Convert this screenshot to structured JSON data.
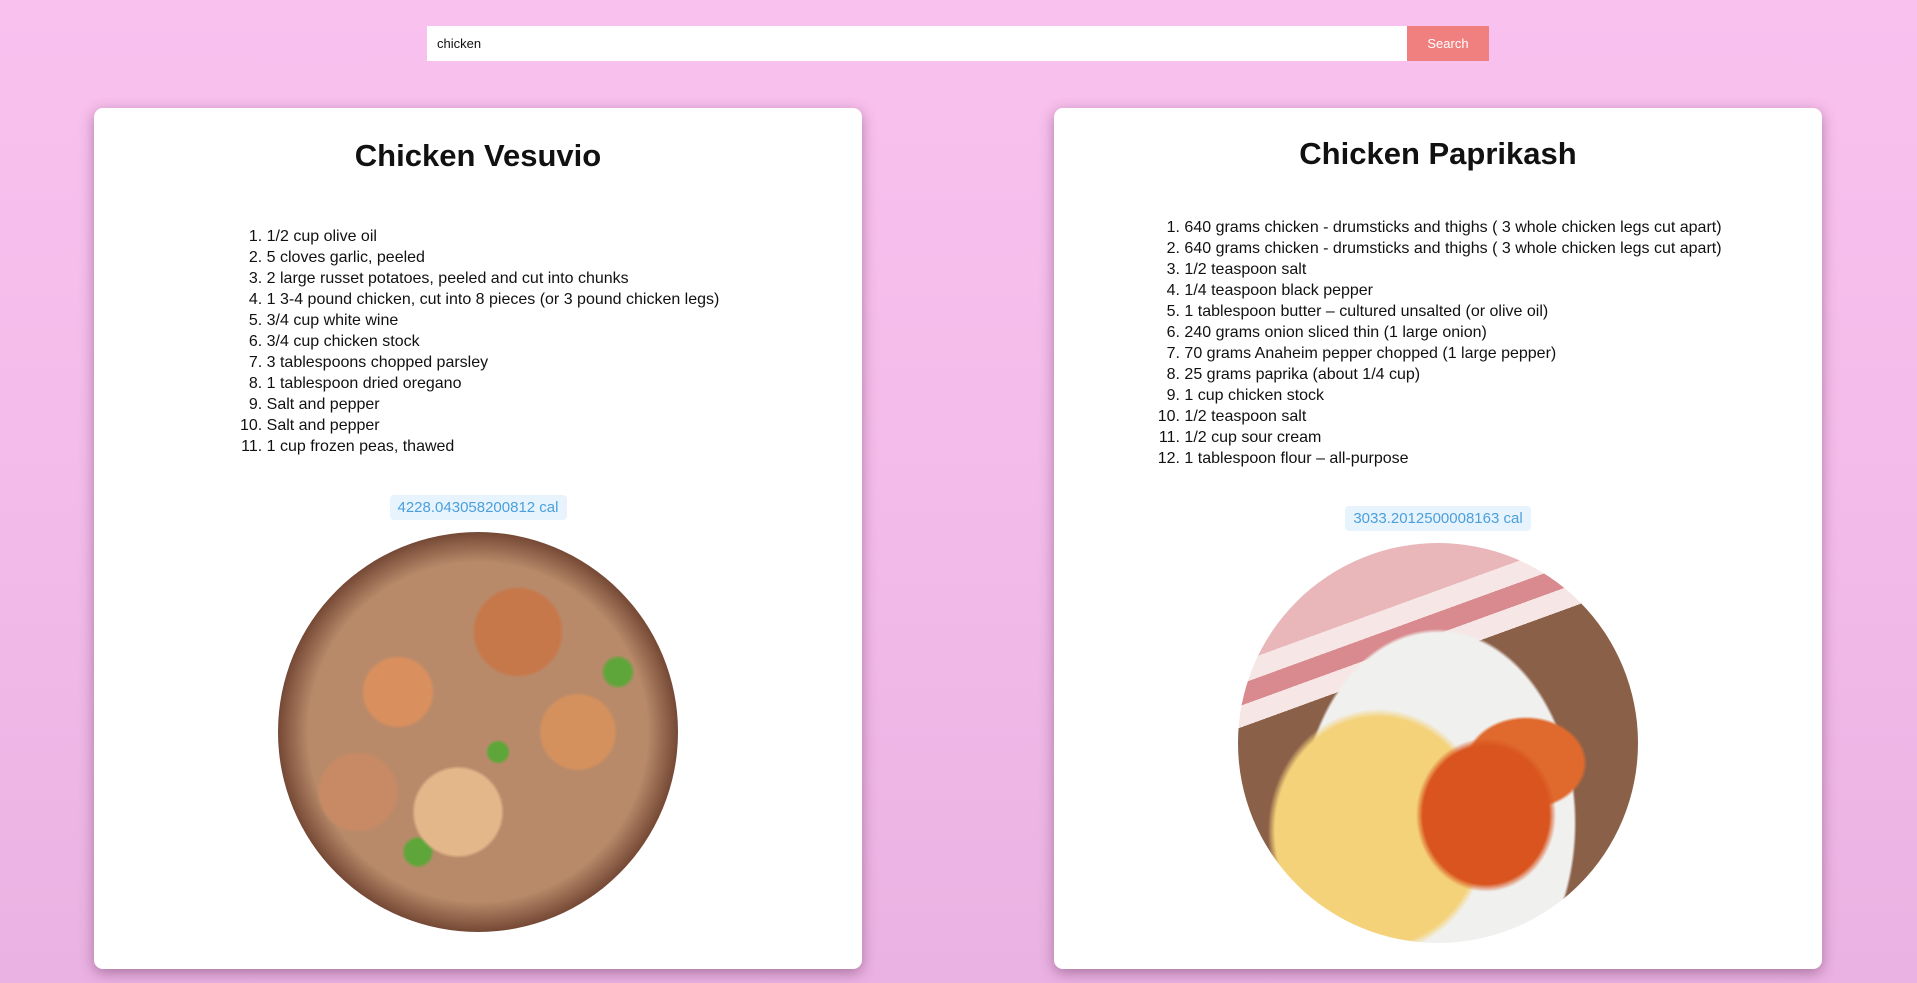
{
  "search": {
    "value": "chicken",
    "button_label": "Search"
  },
  "recipes": [
    {
      "title": "Chicken Vesuvio",
      "ingredients": [
        "1/2 cup olive oil",
        "5 cloves garlic, peeled",
        "2 large russet potatoes, peeled and cut into chunks",
        "1 3-4 pound chicken, cut into 8 pieces (or 3 pound chicken legs)",
        "3/4 cup white wine",
        "3/4 cup chicken stock",
        "3 tablespoons chopped parsley",
        "1 tablespoon dried oregano",
        "Salt and pepper",
        "Salt and pepper",
        "1 cup frozen peas, thawed"
      ],
      "calories": "4228.043058200812 cal"
    },
    {
      "title": "Chicken Paprikash",
      "ingredients": [
        "640 grams chicken - drumsticks and thighs ( 3 whole chicken legs cut apart)",
        "640 grams chicken - drumsticks and thighs ( 3 whole chicken legs cut apart)",
        "1/2 teaspoon salt",
        "1/4 teaspoon black pepper",
        "1 tablespoon butter – cultured unsalted (or olive oil)",
        "240 grams onion sliced thin (1 large onion)",
        "70 grams Anaheim pepper chopped (1 large pepper)",
        "25 grams paprika (about 1/4 cup)",
        "1 cup chicken stock",
        "1/2 teaspoon salt",
        "1/2 cup sour cream",
        "1 tablespoon flour – all-purpose"
      ],
      "calories": "3033.2012500008163 cal"
    }
  ]
}
